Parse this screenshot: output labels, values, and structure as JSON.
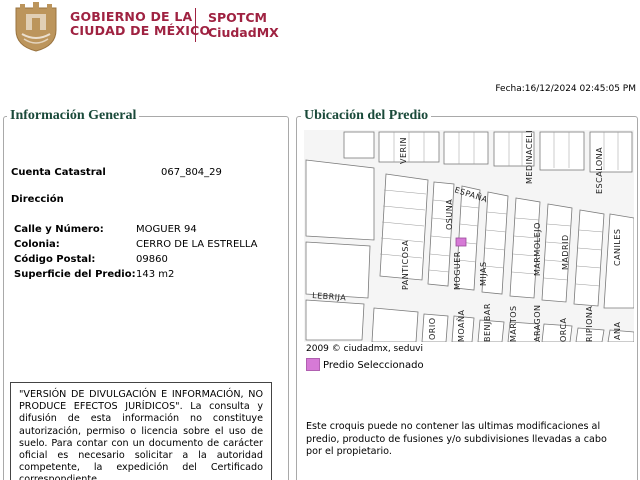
{
  "header": {
    "gov_line1": "GOBIERNO DE LA",
    "gov_line2": "CIUDAD DE MÉXICO",
    "spot_line1": "SPOTCM",
    "spot_line2": "CiudadMX",
    "brand_color": "#9f2241",
    "shield_icon": "cdmx-shield-icon"
  },
  "fecha": "Fecha:16/12/2024 02:45:05 PM",
  "info_general": {
    "title": "Información General",
    "cuenta_label": "Cuenta Catastral",
    "cuenta_value": "067_804_29",
    "direccion_label": "Dirección",
    "fields": [
      {
        "label": "Calle y Número:",
        "value": "MOGUER 94"
      },
      {
        "label": "Colonia:",
        "value": "CERRO DE LA ESTRELLA"
      },
      {
        "label": "Código Postal:",
        "value": "09860"
      },
      {
        "label": "Superficie del Predio:",
        "value": "143 m2"
      }
    ],
    "disclaimer": "\"VERSIÓN DE DIVULGACIÓN E INFORMACIÓN, NO PRODUCE EFECTOS JURÍDICOS\". La consulta y difusión de esta información no constituye autorización, permiso o licencia sobre el uso de suelo. Para contar con un documento de carácter oficial es necesario solicitar a la autoridad competente, la expedición del Certificado correspondiente."
  },
  "ubicacion": {
    "title": "Ubicación del Predio",
    "map_credit": "2009 © ciudadmx, seduvi",
    "legend_label": "Predio Seleccionado",
    "legend_color": "#d67ad6",
    "note": "Este croquis puede no contener las ultimas modificaciones al predio, producto de fusiones y/o subdivisiones llevadas a cabo por el propietario.",
    "streets": {
      "verin": "VERIN",
      "medinaceli": "MEDINACELI",
      "escalona": "ESCALONA",
      "espana": "ESPAÑA",
      "osuna": "OSUNA",
      "panticosa": "PANTICOSA",
      "moguer": "MOGUER",
      "mijas": "MIJAS",
      "marmolejo": "MARMOLEJO",
      "madrid": "MADRID",
      "caniles": "CANILES",
      "lebrija": "LEBRIJA",
      "orio": "ORIO",
      "moana": "MOAÑA",
      "benjbar": "BENJBAR",
      "martos": "MARTOS",
      "aragon": "ARAGON",
      "orca": "ORCA",
      "ripiona": "RIPIONA",
      "ana": "ANA"
    }
  }
}
